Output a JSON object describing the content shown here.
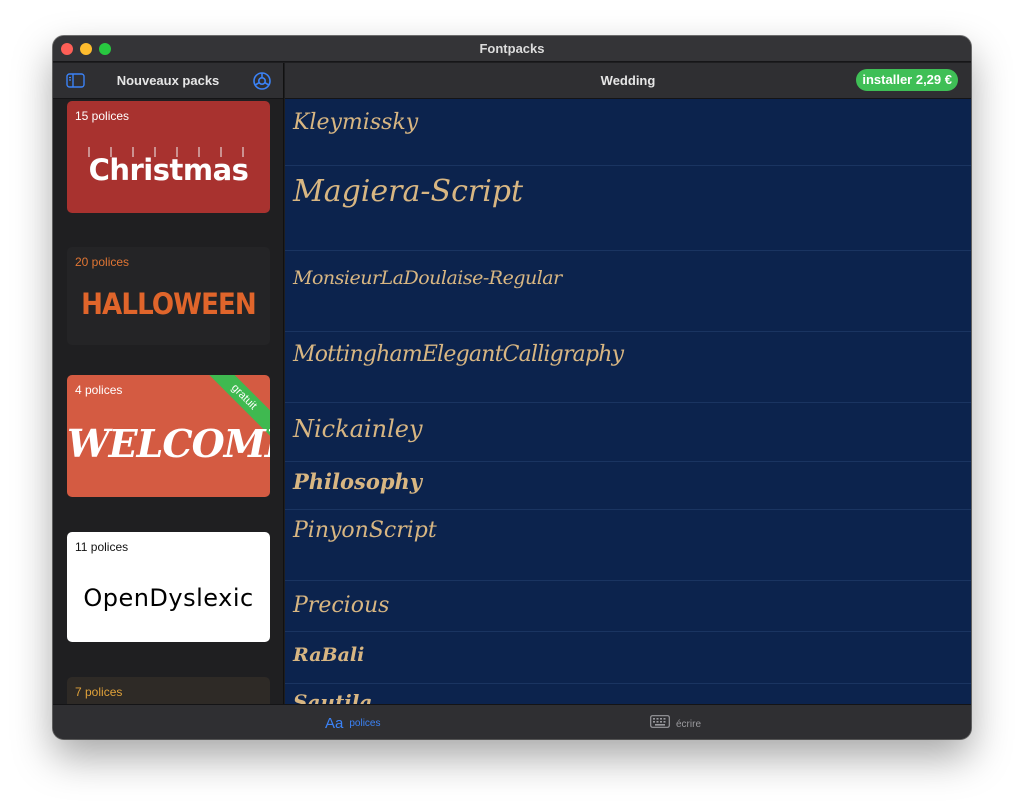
{
  "window": {
    "title": "Fontpacks"
  },
  "sidebar": {
    "title": "Nouveaux packs",
    "packs": [
      {
        "count": "15 polices",
        "label": "Christmas"
      },
      {
        "count": "20 polices",
        "label": "HALLOWEEN"
      },
      {
        "count": "4 polices",
        "label": "WELCOME",
        "ribbon": "gratuit"
      },
      {
        "count": "11 polices",
        "label": "OpenDyslexic"
      },
      {
        "count": "7 polices"
      }
    ]
  },
  "main": {
    "title": "Wedding",
    "install_label": "installer 2,29 €",
    "fonts": [
      "Kleymissky",
      "Magiera-Script",
      "MonsieurLaDoulaise-Regular",
      "MottinghamElegantCalligraphy",
      "Nickainley",
      "Philosophy",
      "PinyonScript",
      "Precious",
      "RaBali",
      "Sautila"
    ]
  },
  "toolbar": {
    "fonts_glyph": "Aa",
    "fonts_label": "polices",
    "write_label": "écrire"
  },
  "colors": {
    "accent": "#3b82f6",
    "install_green": "#3fbf56",
    "ribbon_green": "#3fb950",
    "font_preview": "#d8b682",
    "main_background": "#0c234d"
  }
}
